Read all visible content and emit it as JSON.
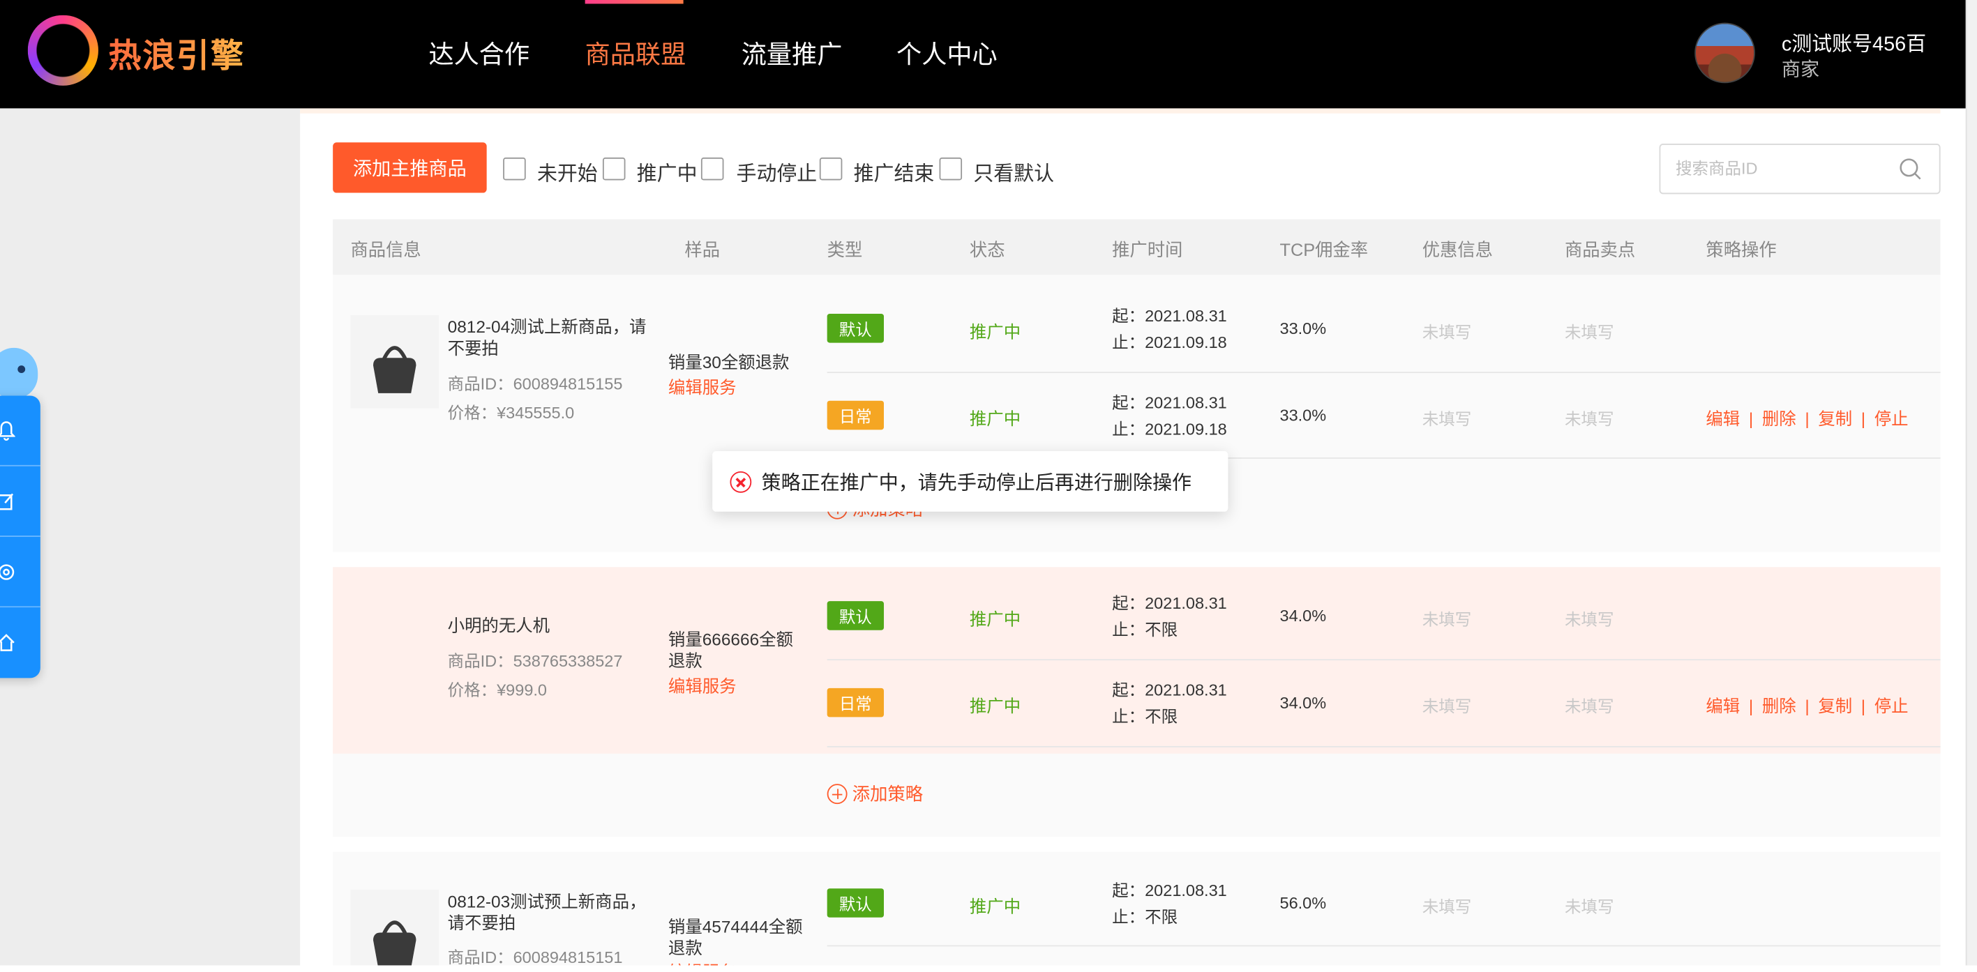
{
  "header": {
    "logo_text": "热浪引擎",
    "nav": [
      "达人合作",
      "商品联盟",
      "流量推广",
      "个人中心"
    ],
    "active_nav": "商品联盟",
    "user_name": "c测试账号456百",
    "user_role": "商家"
  },
  "toolbar": {
    "add_button": "添加主推商品",
    "filters": [
      "未开始",
      "推广中",
      "手动停止",
      "推广结束",
      "只看默认"
    ],
    "search_placeholder": "搜索商品ID"
  },
  "table": {
    "headers": [
      "商品信息",
      "样品",
      "类型",
      "状态",
      "推广时间",
      "TCP佣金率",
      "优惠信息",
      "商品卖点",
      "策略操作"
    ],
    "rows": [
      {
        "name": "0812-04测试上新商品，请不要拍",
        "id": "商品ID：600894815155",
        "price": "价格：¥345555.0",
        "sample": "销量30全额退款",
        "edit_service": "编辑服务",
        "strategies": [
          {
            "type": "默认",
            "status": "推广中",
            "start": "起：2021.08.31",
            "end": "止：2021.09.18",
            "rate": "33.0%",
            "discount": "未填写",
            "selling": "未填写"
          },
          {
            "type": "日常",
            "status": "推广中",
            "start": "起：2021.08.31",
            "end": "止：2021.09.18",
            "rate": "33.0%",
            "discount": "未填写",
            "selling": "未填写"
          }
        ],
        "add_strategy": "添加策略"
      },
      {
        "name": "小明的无人机",
        "id": "商品ID：538765338527",
        "price": "价格：¥999.0",
        "sample": "销量666666全额退款",
        "edit_service": "编辑服务",
        "strategies": [
          {
            "type": "默认",
            "status": "推广中",
            "start": "起：2021.08.31",
            "end": "止：不限",
            "rate": "34.0%",
            "discount": "未填写",
            "selling": "未填写"
          },
          {
            "type": "日常",
            "status": "推广中",
            "start": "起：2021.08.31",
            "end": "止：不限",
            "rate": "34.0%",
            "discount": "未填写",
            "selling": "未填写"
          }
        ],
        "add_strategy": "添加策略"
      },
      {
        "name": "0812-03测试预上新商品，请不要拍",
        "id": "商品ID：600894815151",
        "sample": "销量4574444全额退款",
        "edit_service": "编辑服务",
        "strategies": [
          {
            "type": "默认",
            "status": "推广中",
            "start": "起：2021.08.31",
            "end": "止：不限",
            "rate": "56.0%",
            "discount": "未填写",
            "selling": "未填写"
          }
        ]
      }
    ],
    "ops": [
      "编辑",
      "删除",
      "复制",
      "停止"
    ],
    "op_separator": "|"
  },
  "toast": {
    "message": "策略正在推广中，请先手动停止后再进行删除操作"
  },
  "colors": {
    "accent": "#ff5a2b",
    "status_green": "#52a818",
    "tag_default": "#52a818",
    "tag_daily": "#f5a623",
    "float_panel": "#1890ff"
  }
}
